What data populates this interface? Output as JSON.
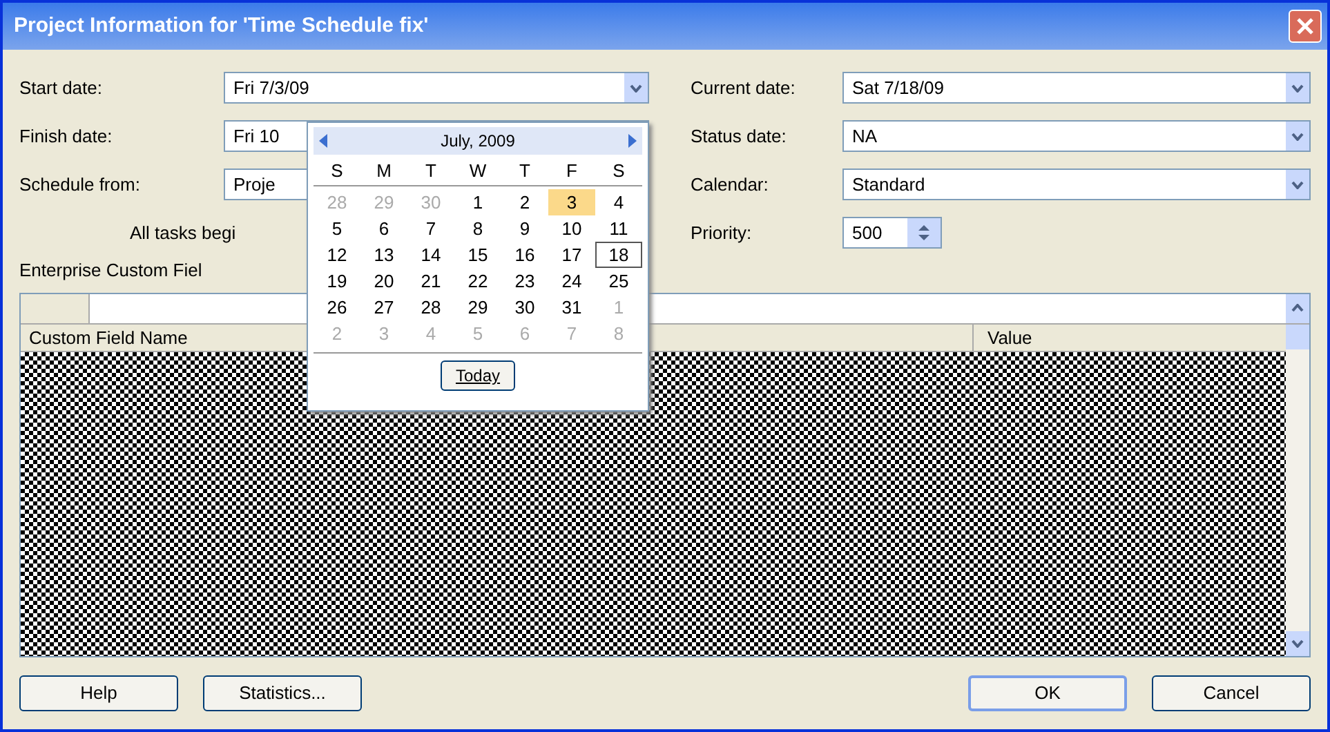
{
  "window": {
    "title": "Project Information for 'Time Schedule fix'"
  },
  "left_fields": [
    {
      "label": "Start date:",
      "value": "Fri 7/3/09",
      "dropdown": true
    },
    {
      "label": "Finish date:",
      "value": "Fri 10"
    },
    {
      "label": "Schedule from:",
      "value": "Proje"
    }
  ],
  "note": "All tasks begi",
  "right_fields": [
    {
      "label": "Current date:",
      "value": "Sat 7/18/09",
      "kind": "dropdown"
    },
    {
      "label": "Status date:",
      "value": "NA",
      "kind": "dropdown"
    },
    {
      "label": "Calendar:",
      "value": "Standard",
      "kind": "dropdown"
    },
    {
      "label": "Priority:",
      "value": "500",
      "kind": "spinner"
    }
  ],
  "enterprise_label": "Enterprise Custom Fiel",
  "table": {
    "columns": [
      "Custom Field Name",
      "Value"
    ]
  },
  "calendar": {
    "month": "July, 2009",
    "weekdays": [
      "S",
      "M",
      "T",
      "W",
      "T",
      "F",
      "S"
    ],
    "days": [
      {
        "day": "28",
        "muted": true,
        "selected": false,
        "today": false
      },
      {
        "day": "29",
        "muted": true,
        "selected": false,
        "today": false
      },
      {
        "day": "30",
        "muted": true,
        "selected": false,
        "today": false
      },
      {
        "day": "1",
        "muted": false,
        "selected": false,
        "today": false
      },
      {
        "day": "2",
        "muted": false,
        "selected": false,
        "today": false
      },
      {
        "day": "3",
        "muted": false,
        "selected": true,
        "today": false
      },
      {
        "day": "4",
        "muted": false,
        "selected": false,
        "today": false
      },
      {
        "day": "5",
        "muted": false,
        "selected": false,
        "today": false
      },
      {
        "day": "6",
        "muted": false,
        "selected": false,
        "today": false
      },
      {
        "day": "7",
        "muted": false,
        "selected": false,
        "today": false
      },
      {
        "day": "8",
        "muted": false,
        "selected": false,
        "today": false
      },
      {
        "day": "9",
        "muted": false,
        "selected": false,
        "today": false
      },
      {
        "day": "10",
        "muted": false,
        "selected": false,
        "today": false
      },
      {
        "day": "11",
        "muted": false,
        "selected": false,
        "today": false
      },
      {
        "day": "12",
        "muted": false,
        "selected": false,
        "today": false
      },
      {
        "day": "13",
        "muted": false,
        "selected": false,
        "today": false
      },
      {
        "day": "14",
        "muted": false,
        "selected": false,
        "today": false
      },
      {
        "day": "15",
        "muted": false,
        "selected": false,
        "today": false
      },
      {
        "day": "16",
        "muted": false,
        "selected": false,
        "today": false
      },
      {
        "day": "17",
        "muted": false,
        "selected": false,
        "today": false
      },
      {
        "day": "18",
        "muted": false,
        "selected": false,
        "today": true
      },
      {
        "day": "19",
        "muted": false,
        "selected": false,
        "today": false
      },
      {
        "day": "20",
        "muted": false,
        "selected": false,
        "today": false
      },
      {
        "day": "21",
        "muted": false,
        "selected": false,
        "today": false
      },
      {
        "day": "22",
        "muted": false,
        "selected": false,
        "today": false
      },
      {
        "day": "23",
        "muted": false,
        "selected": false,
        "today": false
      },
      {
        "day": "24",
        "muted": false,
        "selected": false,
        "today": false
      },
      {
        "day": "25",
        "muted": false,
        "selected": false,
        "today": false
      },
      {
        "day": "26",
        "muted": false,
        "selected": false,
        "today": false
      },
      {
        "day": "27",
        "muted": false,
        "selected": false,
        "today": false
      },
      {
        "day": "28",
        "muted": false,
        "selected": false,
        "today": false
      },
      {
        "day": "29",
        "muted": false,
        "selected": false,
        "today": false
      },
      {
        "day": "30",
        "muted": false,
        "selected": false,
        "today": false
      },
      {
        "day": "31",
        "muted": false,
        "selected": false,
        "today": false
      },
      {
        "day": "1",
        "muted": true,
        "selected": false,
        "today": false
      },
      {
        "day": "2",
        "muted": true,
        "selected": false,
        "today": false
      },
      {
        "day": "3",
        "muted": true,
        "selected": false,
        "today": false
      },
      {
        "day": "4",
        "muted": true,
        "selected": false,
        "today": false
      },
      {
        "day": "5",
        "muted": true,
        "selected": false,
        "today": false
      },
      {
        "day": "6",
        "muted": true,
        "selected": false,
        "today": false
      },
      {
        "day": "7",
        "muted": true,
        "selected": false,
        "today": false
      },
      {
        "day": "8",
        "muted": true,
        "selected": false,
        "today": false
      }
    ],
    "today_button": "Today"
  },
  "buttons": [
    {
      "label": "Help",
      "default": false
    },
    {
      "label": "Statistics...",
      "default": false
    },
    {
      "label": "OK",
      "default": true
    },
    {
      "label": "Cancel",
      "default": false
    }
  ]
}
